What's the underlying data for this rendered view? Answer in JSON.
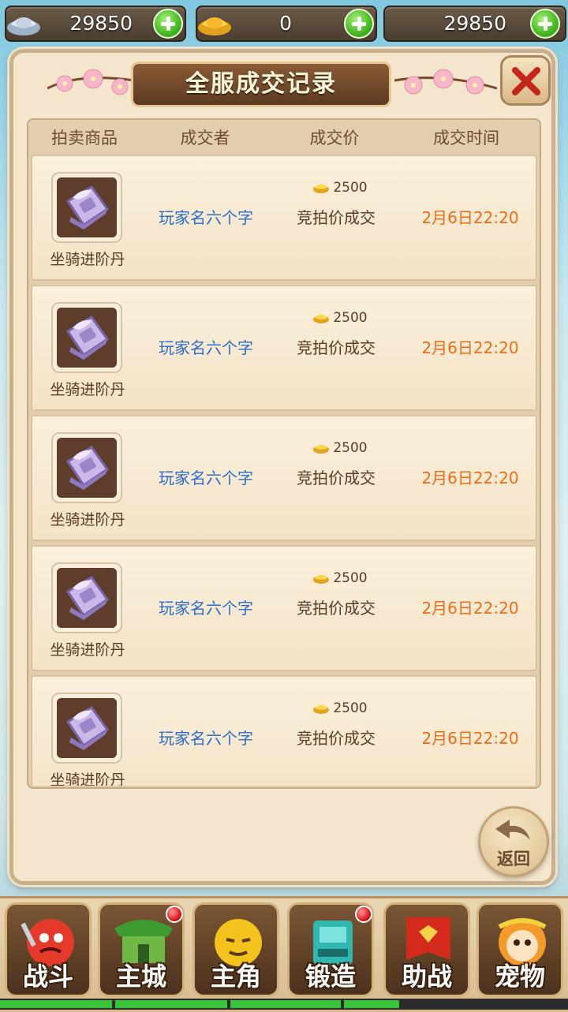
{
  "currencies": [
    {
      "icon": "silver-ingot-icon",
      "value": "29850"
    },
    {
      "icon": "gold-ingot-icon",
      "value": "0"
    },
    {
      "icon": "",
      "value": "29850"
    }
  ],
  "panel": {
    "title": "全服成交记录",
    "columns": [
      "拍卖商品",
      "成交者",
      "成交价",
      "成交时间"
    ],
    "records": [
      {
        "item": "坐骑进阶丹",
        "buyer": "玩家名六个字",
        "price": "2500",
        "deal": "竞拍价成交",
        "time": "2月6日22:20"
      },
      {
        "item": "坐骑进阶丹",
        "buyer": "玩家名六个字",
        "price": "2500",
        "deal": "竞拍价成交",
        "time": "2月6日22:20"
      },
      {
        "item": "坐骑进阶丹",
        "buyer": "玩家名六个字",
        "price": "2500",
        "deal": "竞拍价成交",
        "time": "2月6日22:20"
      },
      {
        "item": "坐骑进阶丹",
        "buyer": "玩家名六个字",
        "price": "2500",
        "deal": "竞拍价成交",
        "time": "2月6日22:20"
      },
      {
        "item": "坐骑进阶丹",
        "buyer": "玩家名六个字",
        "price": "2500",
        "deal": "竞拍价成交",
        "time": "2月6日22:20"
      }
    ],
    "back_label": "返回"
  },
  "nav": [
    {
      "label": "战斗",
      "icon": "battle-icon",
      "badge": false
    },
    {
      "label": "主城",
      "icon": "main-city-icon",
      "badge": true
    },
    {
      "label": "主角",
      "icon": "hero-icon",
      "badge": false
    },
    {
      "label": "锻造",
      "icon": "forge-icon",
      "badge": true
    },
    {
      "label": "助战",
      "icon": "assist-icon",
      "badge": false
    },
    {
      "label": "宠物",
      "icon": "pet-icon",
      "badge": false
    }
  ],
  "colors": {
    "buyer": "#2a6ccc",
    "time": "#ef6c16",
    "accent_green": "#39c23a"
  }
}
